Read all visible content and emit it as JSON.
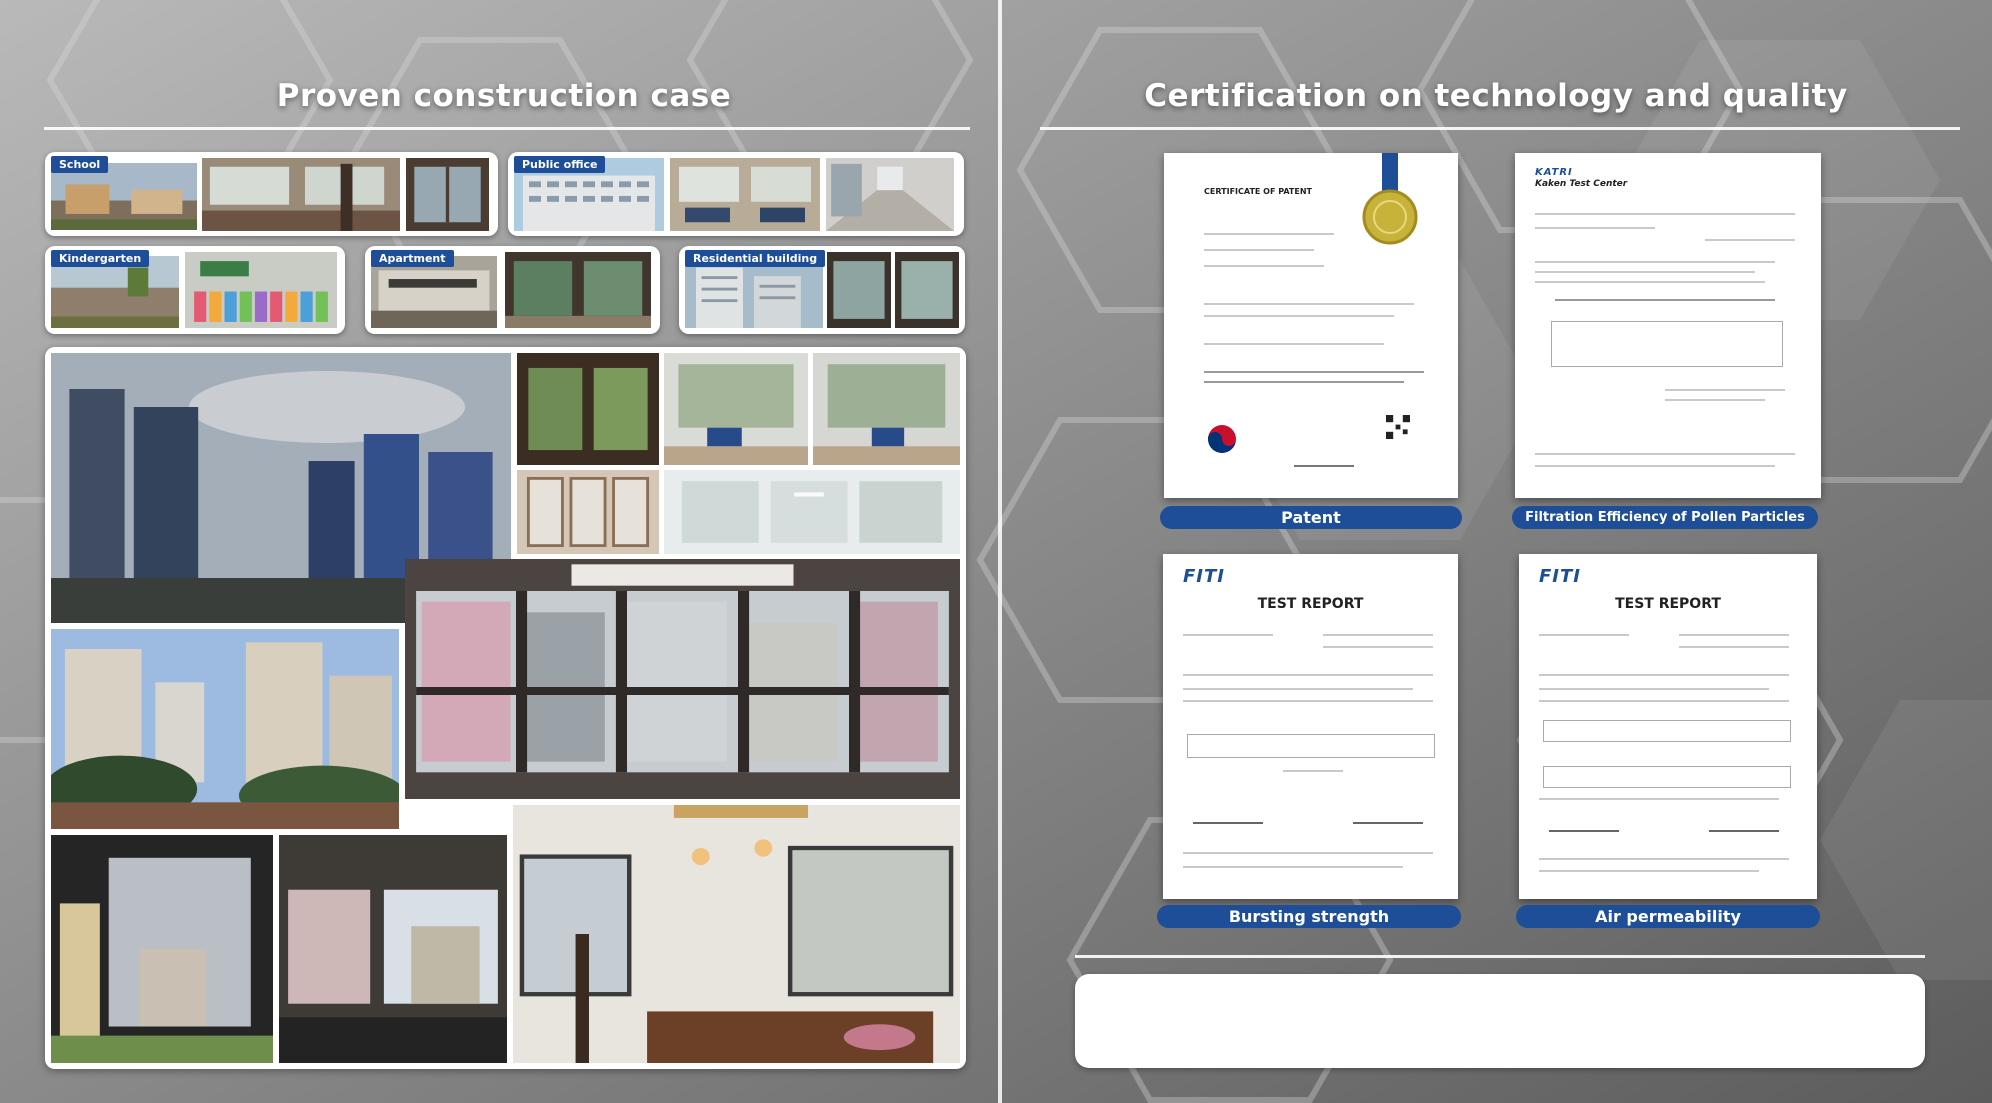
{
  "left": {
    "title": "Proven construction case",
    "tags": {
      "school": "School",
      "public_office": "Public office",
      "kindergarten": "Kindergarten",
      "apartment": "Apartment",
      "residential": "Residential building"
    }
  },
  "right": {
    "title": "Certification on technology and quality",
    "certs": {
      "patent": {
        "label": "Patent",
        "doc_title": "CERTIFICATE OF PATENT"
      },
      "pollen": {
        "label": "Filtration Efficiency of Pollen Particles",
        "brand": "KATRI",
        "doc_title": "Kaken Test Center"
      },
      "bursting": {
        "label": "Bursting strength",
        "brand": "FITI",
        "doc_title": "TEST REPORT"
      },
      "air": {
        "label": "Air permeability",
        "brand": "FITI",
        "doc_title": "TEST REPORT"
      }
    }
  },
  "colors": {
    "accent": "#1d4e97",
    "background": "#7a7a7a"
  }
}
